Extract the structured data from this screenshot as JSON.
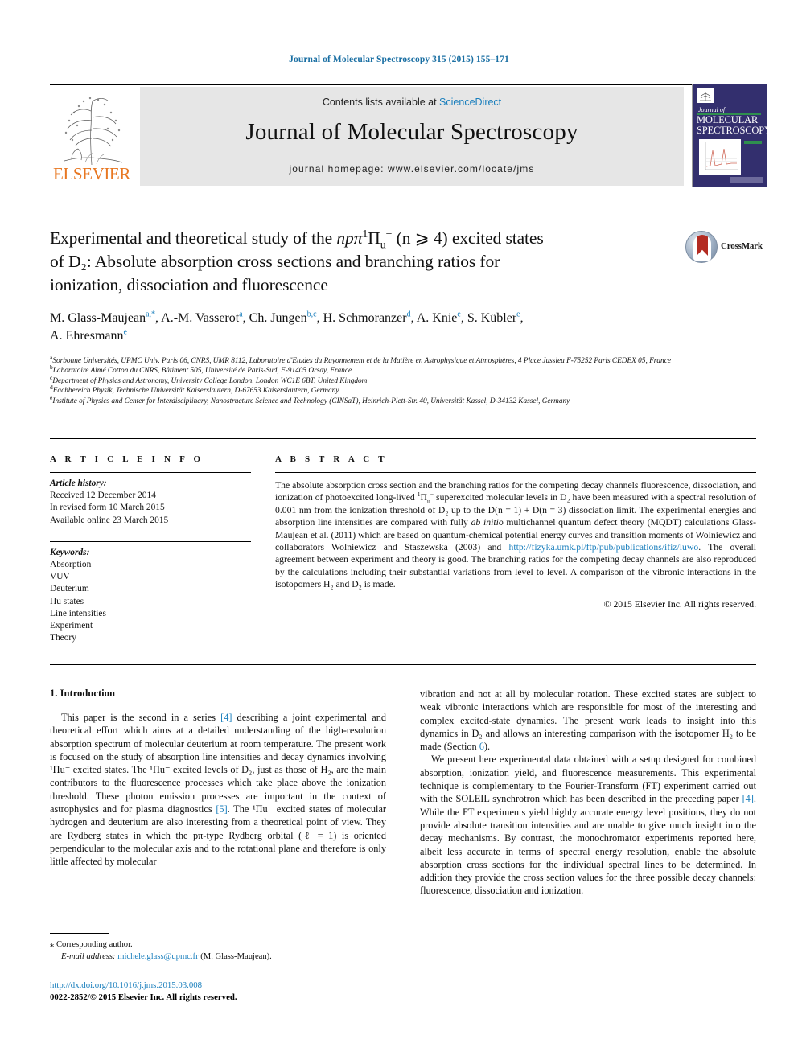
{
  "running_head": "Journal of Molecular Spectroscopy 315 (2015) 155–171",
  "masthead": {
    "contents_prefix": "Contents lists available at ",
    "sciencedirect": "ScienceDirect",
    "journal_title": "Journal of Molecular Spectroscopy",
    "homepage": "journal homepage: www.elsevier.com/locate/jms",
    "publisher_logo_text": "ELSEVIER",
    "cover": {
      "journal_of": "Journal of",
      "name_line1": "MOLECULAR",
      "name_line2": "SPECTROSCOPY"
    }
  },
  "crossmark": {
    "label": "CrossMark"
  },
  "title": {
    "line1_a": "Experimental and theoretical study of the ",
    "line1_math_np": "np",
    "line1_math_pi": "π",
    "line1_sup": "1",
    "line1_PI": "Π",
    "line1_sub": "u",
    "line1_minus": "−",
    "line1_cond": " (n ⩾ 4) excited states",
    "line2": "of D₂: Absolute absorption cross sections and branching ratios for",
    "line3": "ionization, dissociation and fluorescence"
  },
  "authors": {
    "list": [
      {
        "name": "M. Glass-Maujean",
        "sup": "a,*"
      },
      {
        "name": "A.-M. Vasserot",
        "sup": "a"
      },
      {
        "name": "Ch. Jungen",
        "sup": "b,c"
      },
      {
        "name": "H. Schmoranzer",
        "sup": "d"
      },
      {
        "name": "A. Knie",
        "sup": "e"
      },
      {
        "name": "S. Kübler",
        "sup": "e"
      },
      {
        "name": "A. Ehresmann",
        "sup": "e"
      }
    ]
  },
  "affiliations": [
    {
      "mark": "a",
      "text": "Sorbonne Universités, UPMC Univ. Paris 06, CNRS, UMR 8112, Laboratoire d'Etudes du Rayonnement et de la Matière en Astrophysique et Atmosphères, 4 Place Jussieu F-75252 Paris CEDEX 05, France"
    },
    {
      "mark": "b",
      "text": "Laboratoire Aimé Cotton du CNRS, Bâtiment 505, Université de Paris-Sud, F-91405 Orsay, France"
    },
    {
      "mark": "c",
      "text": "Department of Physics and Astronomy, University College London, London WC1E 6BT, United Kingdom"
    },
    {
      "mark": "d",
      "text": "Fachbereich Physik, Technische Universität Kaiserslautern, D-67653 Kaiserslautern, Germany"
    },
    {
      "mark": "e",
      "text": "Institute of Physics and Center for Interdisciplinary, Nanostructure Science and Technology (CINSaT), Heinrich-Plett-Str. 40, Universität Kassel, D-34132 Kassel, Germany"
    }
  ],
  "article_info": {
    "header": "A R T I C L E  I N F O",
    "history_label": "Article history:",
    "history": [
      "Received 12 December 2014",
      "In revised form 10 March 2015",
      "Available online 23 March 2015"
    ],
    "keywords_label": "Keywords:",
    "keywords": [
      "Absorption",
      "VUV",
      "Deuterium",
      "Πu states",
      "Line intensities",
      "Experiment",
      "Theory"
    ]
  },
  "abstract": {
    "header": "A B S T R A C T",
    "text_part1": "The absolute absorption cross section and the branching ratios for the competing decay channels fluorescence, dissociation, and ionization of photoexcited long-lived ",
    "text_part2": " superexcited molecular levels in D₂ have been measured with a spectral resolution of 0.001 nm from the ionization threshold of D₂ up to the D(n = 1) + D(n = 3) dissociation limit. The experimental energies and absorption line intensities are compared with fully ",
    "ab_initio": "ab initio",
    "text_part3": " multichannel quantum defect theory (MQDT) calculations Glass-Maujean et al. (2011) which are based on quantum-chemical potential energy curves and transition moments of Wolniewicz and collaborators Wolniewicz and Staszewska (2003) and ",
    "link": "http://fizyka.umk.pl/ftp/pub/publications/ifiz/luwo",
    "text_part4": ". The overall agreement between experiment and theory is good. The branching ratios for the competing decay channels are also reproduced by the calculations including their substantial variations from level to level. A comparison of the vibronic interactions in the isotopomers H₂ and D₂ is made.",
    "rights": "© 2015 Elsevier Inc. All rights reserved."
  },
  "body": {
    "section_heading": "1. Introduction",
    "left_paragraphs": [
      {
        "p1": "This paper is the second in a series ",
        "ref1": "[4]",
        "p2": " describing a joint experimental and theoretical effort which aims at a detailed understanding of the high-resolution absorption spectrum of molecular deuterium at room temperature. The present work is focused on the study of absorption line intensities and decay dynamics involving ¹Πu⁻ excited states. The ¹Πu⁻ excited levels of D₂, just as those of H₂, are the main contributors to the fluorescence processes which take place above the ionization threshold. These photon emission processes are important in the context of astrophysics and for plasma diagnostics ",
        "ref2": "[5]",
        "p3": ". The ¹Πu⁻ excited states of molecular hydrogen and deuterium are also interesting from a theoretical point of view. They are Rydberg states in which the pπ-type Rydberg orbital (ℓ = 1) is oriented perpendicular to the molecular axis and to the rotational plane and therefore is only little affected by molecular"
      }
    ],
    "right_paragraphs": [
      {
        "p1": "vibration and not at all by molecular rotation. These excited states are subject to weak vibronic interactions which are responsible for most of the interesting and complex excited-state dynamics. The present work leads to insight into this dynamics in D₂ and allows an interesting comparison with the isotopomer H₂ to be made (Section ",
        "ref1": "6",
        "p2": ")."
      },
      {
        "p1": "We present here experimental data obtained with a setup designed for combined absorption, ionization yield, and fluorescence measurements. This experimental technique is complementary to the Fourier-Transform (FT) experiment carried out with the SOLEIL synchrotron which has been described in the preceding paper ",
        "ref1": "[4]",
        "p2": ". While the FT experiments yield highly accurate energy level positions, they do not provide absolute transition intensities and are unable to give much insight into the decay mechanisms. By contrast, the monochromator experiments reported here, albeit less accurate in terms of spectral energy resolution, enable the absolute absorption cross sections for the individual spectral lines to be determined. In addition they provide the cross section values for the three possible decay channels: fluorescence, dissociation and ionization."
      }
    ]
  },
  "footnote": {
    "star": "⁎",
    "corresponding": "Corresponding author.",
    "email_label": "E-mail address:",
    "email": "michele.glass@upmc.fr",
    "email_owner": "(M. Glass-Maujean)."
  },
  "footer": {
    "doi": "http://dx.doi.org/10.1016/j.jms.2015.03.008",
    "issn_copyright": "0022-2852/© 2015 Elsevier Inc. All rights reserved."
  },
  "colors": {
    "link": "#1a7fbd",
    "elsevier_orange": "#E87722",
    "panel_grey": "#e6e6e6",
    "cover_navy": "#332f6e",
    "crossmark_red": "#b32b22"
  }
}
